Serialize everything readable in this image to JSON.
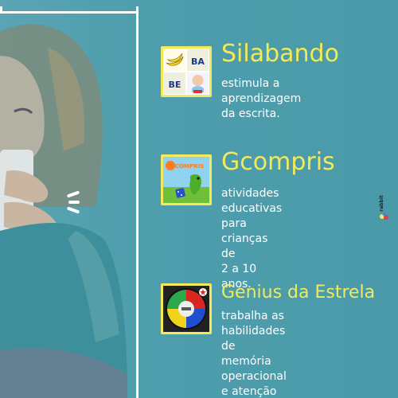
{
  "items": [
    {
      "title": "Silabando",
      "description": "estimula a aprendizagem\nda escrita.",
      "thumb_text": [
        "BA",
        "BE"
      ]
    },
    {
      "title": "Gcompris",
      "description": "atividades educativas\npara crianças de\n2 a 10 anos.",
      "thumb_text": [
        "GCOMPRIS"
      ]
    },
    {
      "title": "Genius da Estrela",
      "description": "trabalha as habilidades\nde memória operacional\ne atenção visual."
    }
  ],
  "brand": {
    "logo_text": "rabbit"
  },
  "colors": {
    "background": "#4b9aa8",
    "title_yellow": "#f2ea5a",
    "text_white": "#ffffff"
  }
}
